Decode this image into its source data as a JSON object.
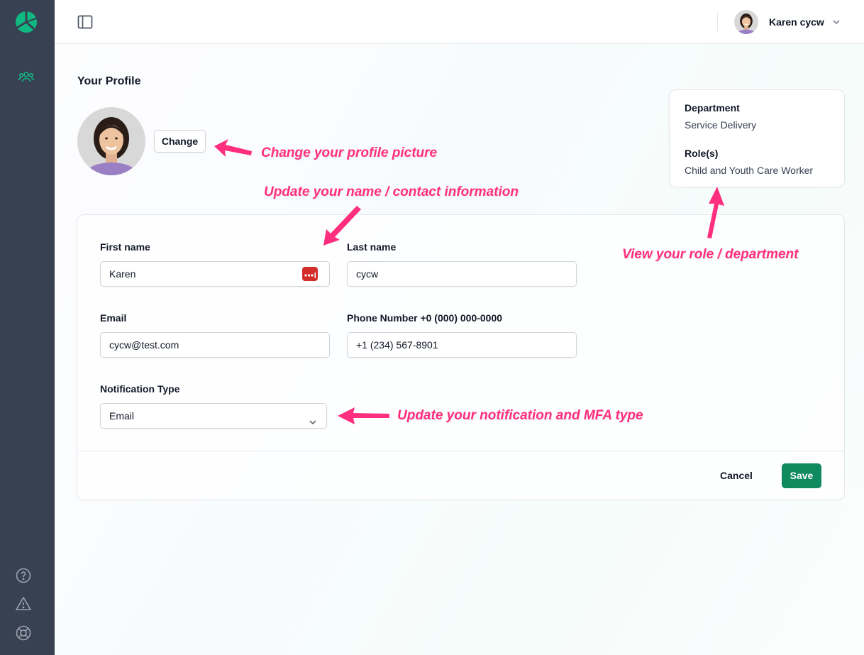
{
  "user": {
    "name": "Karen cycw"
  },
  "page": {
    "title": "Your Profile"
  },
  "profile": {
    "change_label": "Change"
  },
  "info_card": {
    "department_label": "Department",
    "department_value": "Service Delivery",
    "roles_label": "Role(s)",
    "roles_value": "Child and Youth Care Worker"
  },
  "form": {
    "first_name": {
      "label": "First name",
      "value": "Karen"
    },
    "last_name": {
      "label": "Last name",
      "value": "cycw"
    },
    "email": {
      "label": "Email",
      "value": "cycw@test.com"
    },
    "phone": {
      "label": "Phone Number +0 (000) 000-0000",
      "value": "+1 (234) 567-8901"
    },
    "notification": {
      "label": "Notification Type",
      "value": "Email"
    },
    "cancel_label": "Cancel",
    "save_label": "Save"
  },
  "annotations": {
    "profile_picture": "Change your profile picture",
    "name_contact": "Update your name / contact information",
    "role_department": "View your role / department",
    "notification_mfa": "Update your notification and MFA type"
  },
  "colors": {
    "sidebar": "#374151",
    "accent": "#10b981",
    "save_button": "#0f8a5f",
    "annotation": "#ff2e7e"
  },
  "icons": {
    "logo": "leaf-logo-icon",
    "nav": "users-icon",
    "sidebar_toggle": "sidebar-toggle-icon",
    "help": "help-circle-icon",
    "warning": "warning-triangle-icon",
    "support": "lifebuoy-icon"
  }
}
